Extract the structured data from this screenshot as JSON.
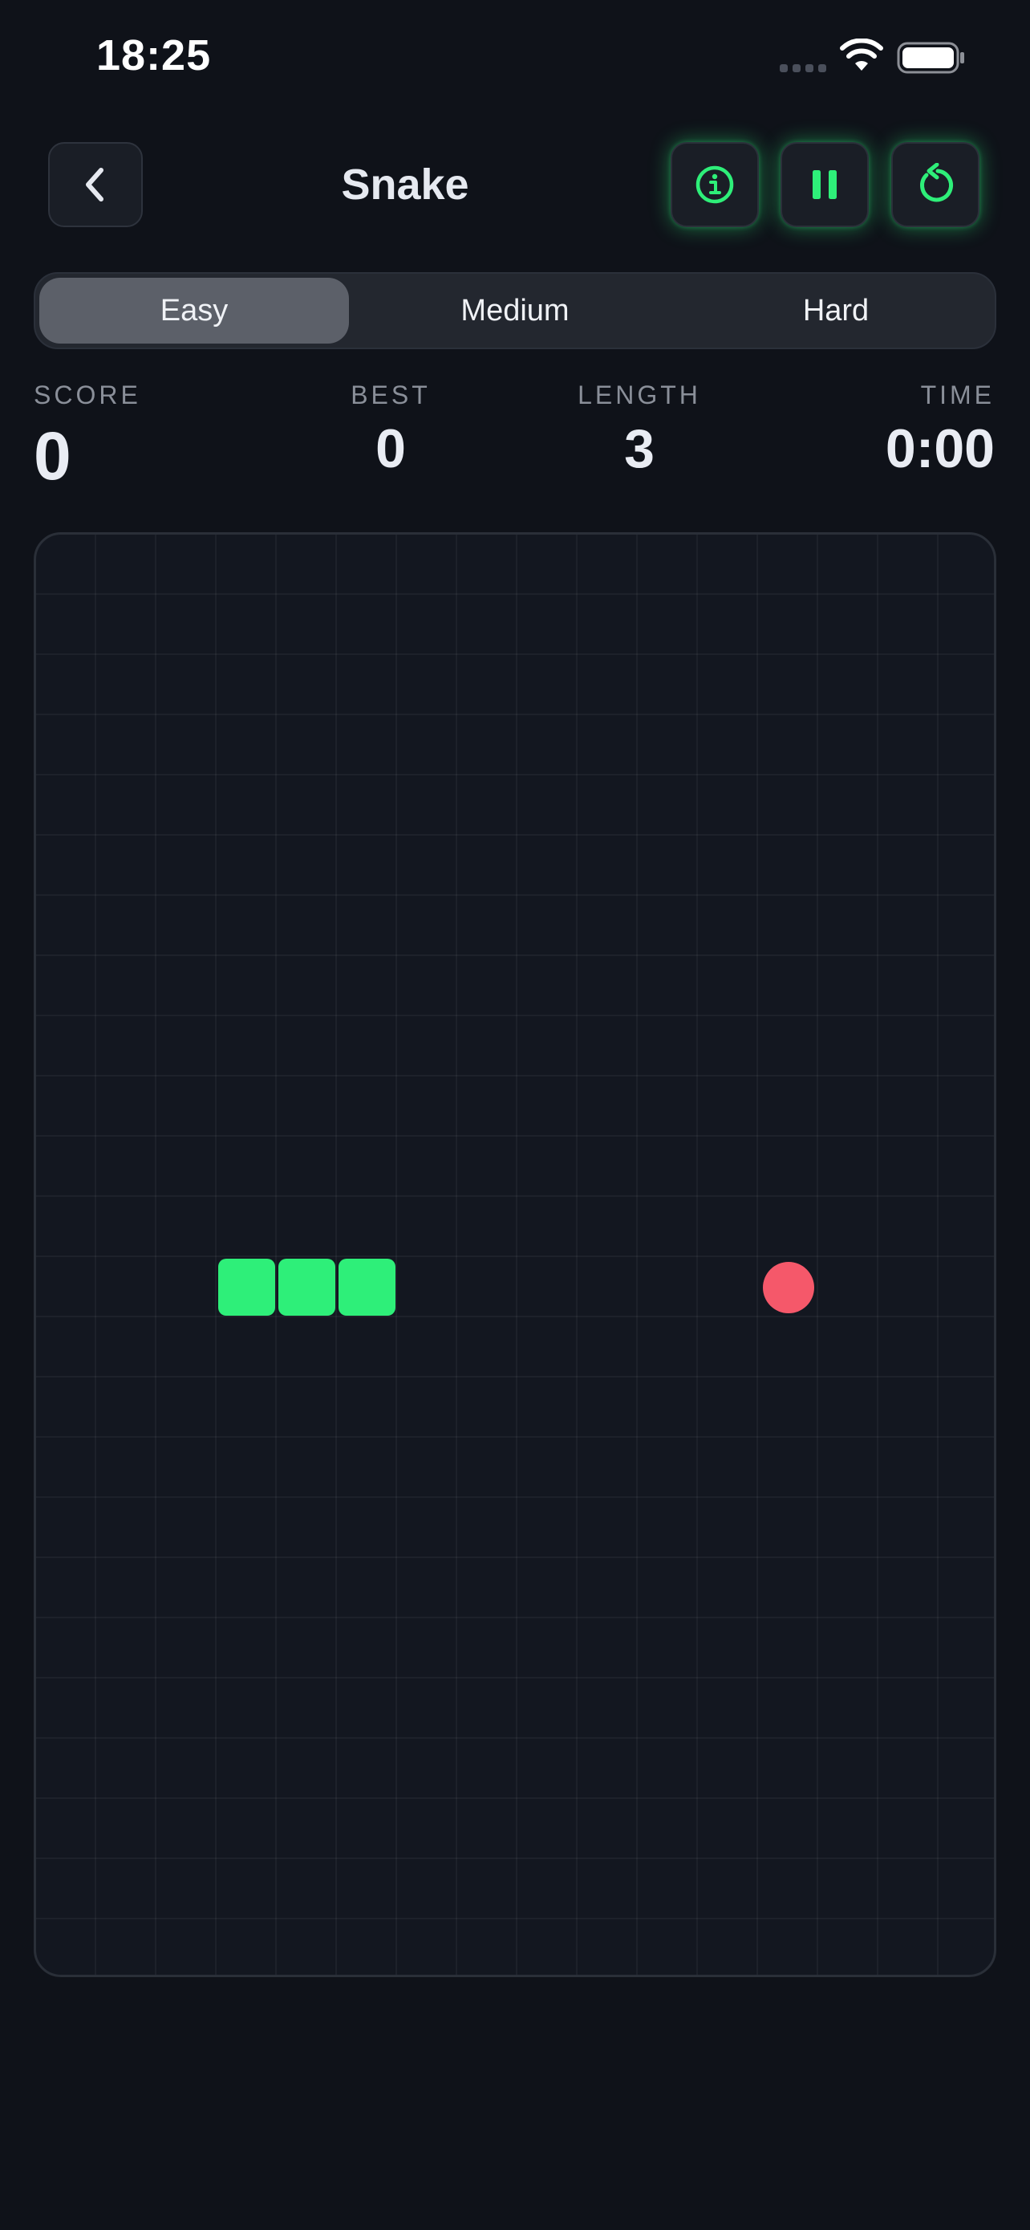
{
  "status_bar": {
    "time": "18:25",
    "signal_icon": "cellular-dots-icon",
    "wifi_icon": "wifi-icon",
    "battery_icon": "battery-full-icon"
  },
  "header": {
    "title": "Snake",
    "back_icon": "chevron-left-icon",
    "info_icon": "info-circle-icon",
    "pause_icon": "pause-icon",
    "restart_icon": "restart-arrow-icon",
    "accent_color": "#2eef79"
  },
  "difficulty": {
    "options": [
      "Easy",
      "Medium",
      "Hard"
    ],
    "selected": "Easy"
  },
  "stats": {
    "score_label": "SCORE",
    "score": "0",
    "best_label": "BEST",
    "best": "0",
    "length_label": "LENGTH",
    "length": "3",
    "time_label": "TIME",
    "time": "0:00"
  },
  "board": {
    "columns": 16,
    "rows": 24,
    "snake": [
      {
        "col": 3,
        "row": 12
      },
      {
        "col": 4,
        "row": 12
      },
      {
        "col": 5,
        "row": 12
      }
    ],
    "food": {
      "col": 12,
      "row": 12
    },
    "snake_color": "#2eef79",
    "food_color": "#f5586a"
  }
}
